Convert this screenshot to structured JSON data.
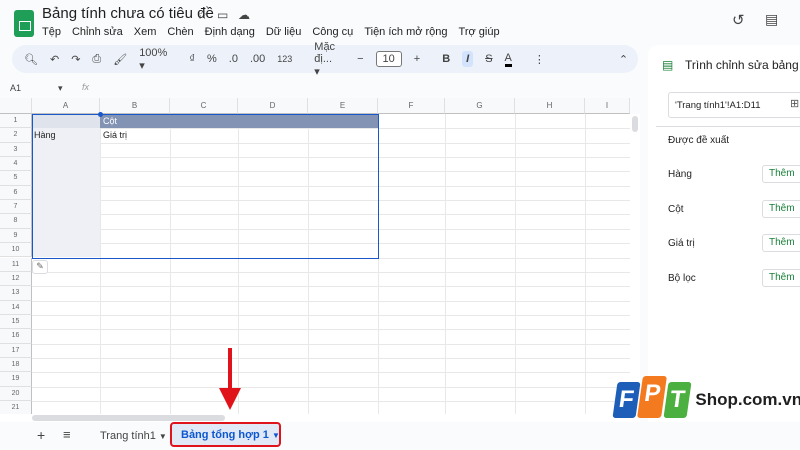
{
  "title": "Bảng tính chưa có tiêu đề",
  "menu": [
    "Tệp",
    "Chỉnh sửa",
    "Xem",
    "Chèn",
    "Định dạng",
    "Dữ liệu",
    "Công cụ",
    "Tiện ích mở rộng",
    "Trợ giúp"
  ],
  "toolbar": {
    "zoom": "100%",
    "currency": "₫",
    "percent": "%",
    "dec_less": ".0",
    "dec_more": ".00",
    "format_123": "123",
    "font": "Mặc đị...",
    "font_size": "10",
    "bold": "B",
    "italic": "I",
    "strike": "S",
    "textcolor": "A"
  },
  "formula": {
    "cell_ref": "A1",
    "fx": "fx"
  },
  "columns": [
    "A",
    "B",
    "C",
    "D",
    "E",
    "F",
    "G",
    "H",
    "I"
  ],
  "rows": [
    "1",
    "2",
    "3",
    "4",
    "5",
    "6",
    "7",
    "8",
    "9",
    "10",
    "11",
    "12",
    "13",
    "14",
    "15",
    "16",
    "17",
    "18",
    "19",
    "20",
    "21"
  ],
  "pivot": {
    "columns_label": "Cột",
    "rows_label": "Hàng",
    "values_label": "Giá trị",
    "header_color": "#8293b4",
    "row_color": "#eef0f5",
    "border_color": "#1a57c8"
  },
  "panel": {
    "title": "Trình chỉnh sửa bảng t",
    "range": "'Trang tính1'!A1:D11",
    "suggested": "Được đề xuất",
    "sections": [
      {
        "label": "Hàng",
        "button": "Thêm"
      },
      {
        "label": "Cột",
        "button": "Thêm"
      },
      {
        "label": "Giá trị",
        "button": "Thêm"
      },
      {
        "label": "Bộ lọc",
        "button": "Thêm"
      }
    ]
  },
  "sheets": [
    {
      "name": "Trang tính1",
      "active": false
    },
    {
      "name": "Bảng tổng hợp 1",
      "active": true
    }
  ],
  "watermark": {
    "brand": "FPT",
    "shop": "Shop.com.vn"
  },
  "annotation_color": "#e0131b"
}
